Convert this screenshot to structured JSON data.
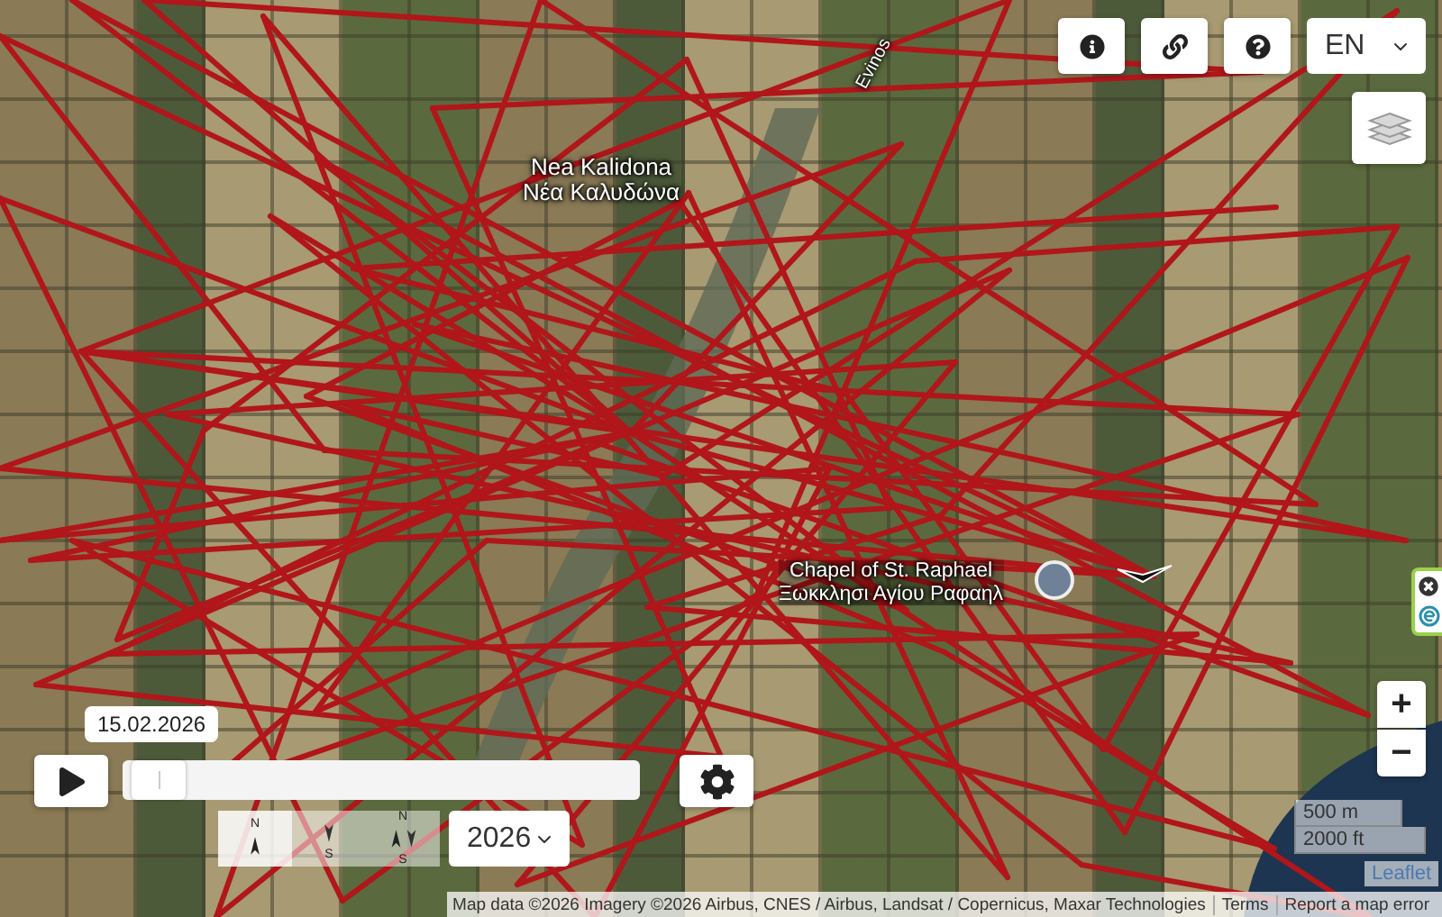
{
  "map": {
    "labels": [
      {
        "kind": "place",
        "lines": [
          "Nea Kalidona",
          "Νέα Καλυδώνα"
        ]
      },
      {
        "kind": "poi",
        "lines": [
          "Chapel of St. Raphael",
          "Ξωκκλησι Αγίου Ραφαηλ"
        ]
      },
      {
        "kind": "road",
        "lines": [
          "Evinos"
        ]
      }
    ]
  },
  "toolbar": {
    "buttons": [
      {
        "kind": "info"
      },
      {
        "kind": "link"
      },
      {
        "kind": "help"
      }
    ],
    "language": "EN"
  },
  "timeline": {
    "date": "15.02.2026",
    "level": 0.02
  },
  "orientation": [
    {
      "north": "N",
      "selected": true
    },
    {
      "south": "S",
      "selected": false
    },
    {
      "north": "N",
      "south": "S",
      "selected": false
    }
  ],
  "year": "2026",
  "zoom": [
    "+",
    "−"
  ],
  "scale": [
    "500 m",
    "2000 ft"
  ],
  "attribution": {
    "leaflet": "Leaflet",
    "text": "Map data ©2026 Imagery ©2026 Airbus, CNES / Airbus, Landsat / Copernicus, Maxar Technologies",
    "links": [
      "Terms",
      "Report a map error"
    ]
  }
}
